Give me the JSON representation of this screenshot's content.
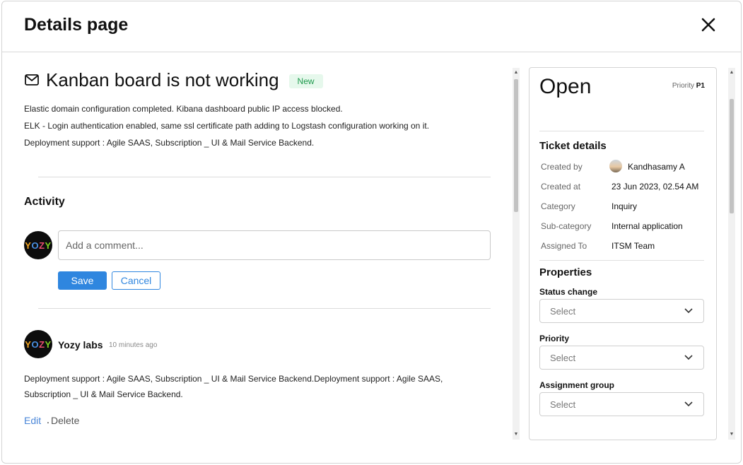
{
  "header": {
    "title": "Details page"
  },
  "ticket": {
    "title": "Kanban board is not working",
    "badge": "New",
    "description": [
      "Elastic domain configuration completed. Kibana dashboard public IP access blocked.",
      "ELK - Login authentication enabled, same ssl certificate path adding to Logstash configuration working on it.",
      "Deployment support : Agile SAAS, Subscription _ UI & Mail Service Backend."
    ]
  },
  "activity": {
    "title": "Activity",
    "avatar_text": [
      "Y",
      "O",
      "Z",
      "Y"
    ],
    "comment_placeholder": "Add a comment...",
    "save_label": "Save",
    "cancel_label": "Cancel",
    "comments": [
      {
        "author": "Yozy labs",
        "time": "10 minutes ago",
        "body": "Deployment support : Agile SAAS, Subscription _ UI & Mail Service Backend.Deployment support : Agile SAAS, Subscription _ UI & Mail Service Backend.",
        "edit_label": "Edit",
        "separator": ".",
        "delete_label": "Delete"
      }
    ]
  },
  "panel": {
    "status": "Open",
    "priority_label": "Priority",
    "priority_value": "P1",
    "ticket_details_title": "Ticket details",
    "details": [
      {
        "key": "Created by",
        "value": "Kandhasamy A"
      },
      {
        "key": "Created at",
        "value": "23 Jun 2023, 02.54 AM"
      },
      {
        "key": "Category",
        "value": "Inquiry"
      },
      {
        "key": "Sub-category",
        "value": "Internal application"
      },
      {
        "key": "Assigned To",
        "value": "ITSM Team"
      }
    ],
    "properties_title": "Properties",
    "fields": [
      {
        "label": "Status change",
        "placeholder": "Select"
      },
      {
        "label": "Priority",
        "placeholder": "Select"
      },
      {
        "label": "Assignment group",
        "placeholder": "Select"
      }
    ]
  },
  "colors": {
    "primary": "#2f86df",
    "badge_bg": "#e6f8ec",
    "badge_text": "#1f9a4d",
    "link": "#4a86d8"
  }
}
